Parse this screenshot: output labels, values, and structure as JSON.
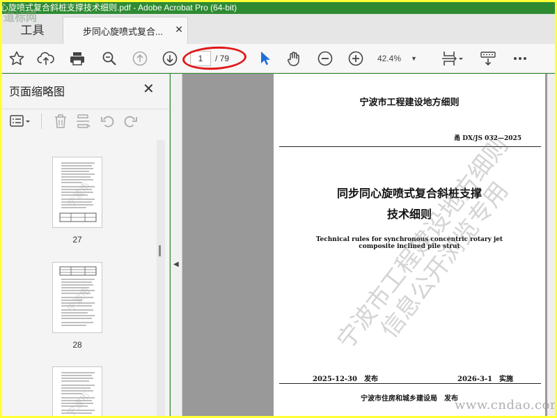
{
  "window": {
    "title": "心旋喷式复合斜桩支撑技术细则.pdf - Adobe Acrobat Pro (64-bit)"
  },
  "tabs": {
    "tools_label": "工具",
    "doc_label": "步同心旋喷式复合..."
  },
  "toolbar": {
    "current_page": "1",
    "total_pages": "/ 79",
    "zoom": "42.4%",
    "accent_color": "#1f6fd6",
    "highlight_color": "#e01818"
  },
  "panel": {
    "title": "页面缩略图",
    "thumbnails": [
      {
        "page": "27"
      },
      {
        "page": "28"
      },
      {
        "page": ""
      }
    ]
  },
  "document": {
    "header": "宁波市工程建设地方细则",
    "code": "甬 DX/JS 032—2025",
    "title_line1": "同步同心旋喷式复合斜桩支撑",
    "title_line2": "技术细则",
    "english_line1": "Technical rules for synchronous concentric rotary jet",
    "english_line2": "composite inclined pile strut",
    "issue_date": "2025-12-30　发布",
    "implement_date": "2026-3-1　实施",
    "publisher": "宁波市住房和城乡建设局　发布",
    "watermark_line1": "宁波市工程建设地方细则",
    "watermark_line2": "信息公开浏览专用"
  },
  "overlay": {
    "site_watermark": "www.cndao.com",
    "corner_logo": "道标网"
  }
}
